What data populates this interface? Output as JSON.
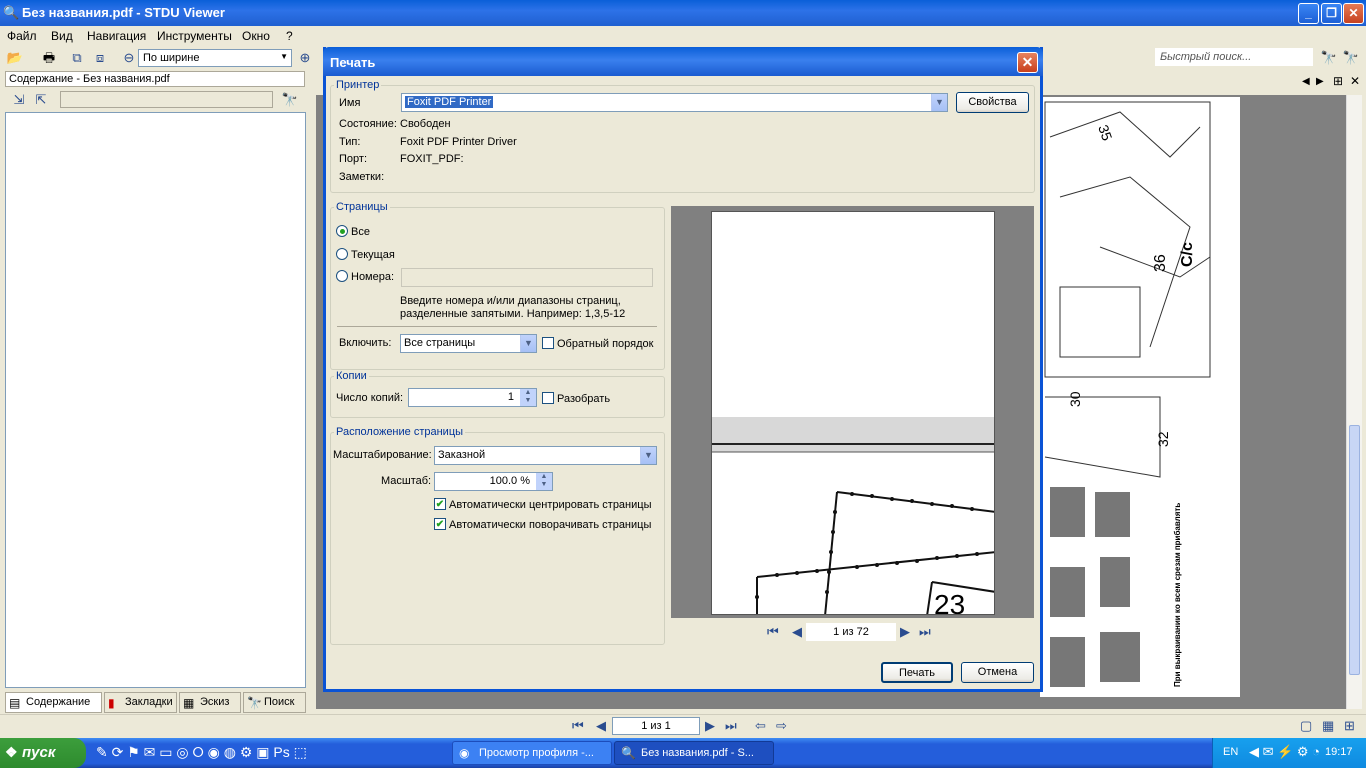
{
  "window": {
    "title": "Без названия.pdf - STDU Viewer"
  },
  "menu": [
    "Файл",
    "Вид",
    "Навигация",
    "Инструменты",
    "Окно",
    "?"
  ],
  "toolbar": {
    "zoom_mode": "По ширине",
    "search_placeholder": "Быстрый поиск..."
  },
  "left_panel": {
    "header": "Содержание - Без названия.pdf",
    "tabs": [
      "Содержание",
      "Закладки",
      "Эскиз",
      "Поиск"
    ]
  },
  "status": {
    "page_indicator": "1 из 1"
  },
  "dialog": {
    "title": "Печать",
    "printer": {
      "group": "Принтер",
      "name_label": "Имя",
      "name_value": "Foxit PDF Printer",
      "properties_button": "Свойства",
      "state_label": "Состояние:",
      "state_value": "Свободен",
      "type_label": "Тип:",
      "type_value": "Foxit PDF Printer Driver",
      "port_label": "Порт:",
      "port_value": "FOXIT_PDF:",
      "notes_label": "Заметки:"
    },
    "pages": {
      "group": "Страницы",
      "all": "Все",
      "current": "Текущая",
      "numbers": "Номера:",
      "hint": "Введите номера и/или диапазоны страниц,",
      "hint2": "разделенные запятыми. Например: 1,3,5-12",
      "include_label": "Включить:",
      "include_value": "Все страницы",
      "reverse_label": "Обратный порядок"
    },
    "copies": {
      "group": "Копии",
      "count_label": "Число копий:",
      "count_value": "1",
      "collate_label": "Разобрать"
    },
    "layout": {
      "group": "Расположение страницы",
      "scaling_label": "Масштабирование:",
      "scaling_value": "Заказной",
      "scale_label": "Масштаб:",
      "scale_value": "100.0 %",
      "auto_center": "Автоматически центрировать страницы",
      "auto_rotate": "Автоматически поворачивать страницы"
    },
    "preview_page": "1 из 72",
    "print_button": "Печать",
    "cancel_button": "Отмена"
  },
  "taskbar": {
    "start": "пуск",
    "tasks": [
      "Просмотр профиля -...",
      "Без названия.pdf - S..."
    ],
    "lang": "EN",
    "clock": "19:17"
  }
}
